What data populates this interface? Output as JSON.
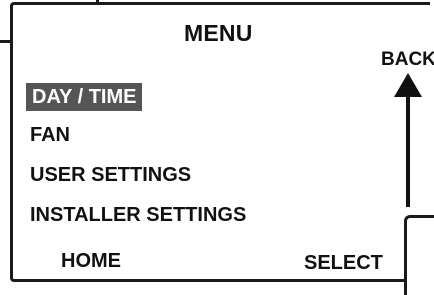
{
  "menu": {
    "title": "MENU",
    "back_label": "BACK",
    "items": [
      {
        "label": "DAY / TIME",
        "selected": true
      },
      {
        "label": "FAN",
        "selected": false
      },
      {
        "label": "USER SETTINGS",
        "selected": false
      },
      {
        "label": "INSTALLER SETTINGS",
        "selected": false
      }
    ]
  },
  "softkeys": {
    "left_label": "HOME",
    "right_label": "SELECT"
  },
  "colors": {
    "selection_highlight": "#555555",
    "selection_text": "#ffffff",
    "text": "#111111",
    "border": "#1a1a1a"
  },
  "icons": {
    "back": "up-arrow-icon"
  }
}
